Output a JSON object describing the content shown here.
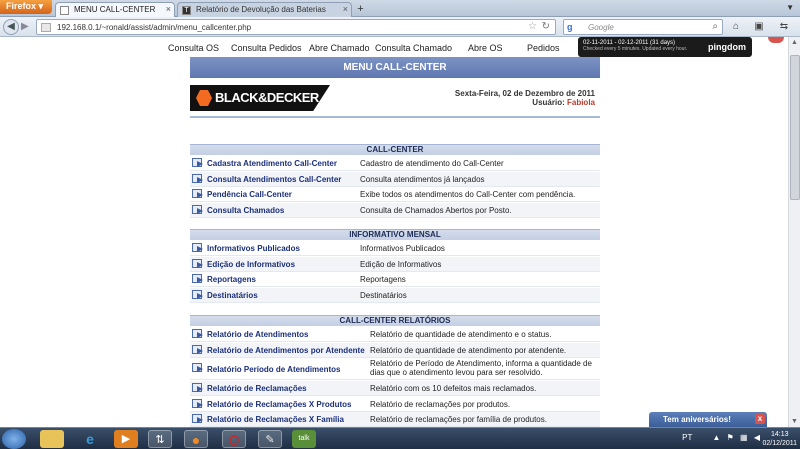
{
  "browser": {
    "menu_label": "Firefox ▾",
    "tabs": [
      {
        "title": "MENU CALL-CENTER"
      },
      {
        "title": "Relatório de Devolução das Baterias",
        "icon_letter": "T"
      }
    ],
    "url": "192.168.0.1/~ronald/assist/admin/menu_callcenter.php",
    "search_placeholder": "Google",
    "search_engine_letter": "g"
  },
  "pingdom": {
    "line1": "02-11-2011 - 02-12-2011 (31 days)",
    "line2": "Checked every 5 minutes. Updated every hour.",
    "logo": "pingdom"
  },
  "top_menu": [
    "Consulta OS",
    "Consulta Pedidos",
    "Abre Chamado",
    "Consulta Chamado",
    "Abre OS",
    "Pedidos"
  ],
  "page": {
    "header_title": "MENU CALL-CENTER",
    "brand": "BLACK&DECKER",
    "date_text": "Sexta-Feira, 02 de Dezembro de 2011",
    "user_label": "Usuário:",
    "user_name": "Fabiola"
  },
  "sections": [
    {
      "title": "CALL-CENTER",
      "rows": [
        {
          "link": "Cadastra Atendimento Call-Center",
          "desc": "Cadastro de atendimento do Call-Center"
        },
        {
          "link": "Consulta Atendimentos Call-Center",
          "desc": "Consulta atendimentos já lançados"
        },
        {
          "link": "Pendência Call-Center",
          "desc": "Exibe todos os atendimentos do Call-Center com pendência."
        },
        {
          "link": "Consulta Chamados",
          "desc": "Consulta de Chamados Abertos por Posto."
        }
      ]
    },
    {
      "title": "INFORMATIVO MENSAL",
      "rows": [
        {
          "link": "Informativos Publicados",
          "desc": "Informativos Publicados"
        },
        {
          "link": "Edição de Informativos",
          "desc": "Edição de Informativos"
        },
        {
          "link": "Reportagens",
          "desc": "Reportagens"
        },
        {
          "link": "Destinatários",
          "desc": "Destinatários"
        }
      ]
    },
    {
      "title": "CALL-CENTER RELATÓRIOS",
      "rows": [
        {
          "link": "Relatório de Atendimentos",
          "desc": "Relatório de quantidade de atendimento e o status."
        },
        {
          "link": "Relatório de Atendimentos por Atendente",
          "desc": "Relatório de quantidade de atendimento por atendente."
        },
        {
          "link": "Relatório Período de Atendimentos",
          "desc": "Relatório de Período de Atendimento, informa a quantidade de dias que o atendimento levou para ser resolvido."
        },
        {
          "link": "Relatório de Reclamações",
          "desc": "Relatório com os 10 defeitos mais reclamados."
        },
        {
          "link": "Relatório de Reclamações X Produtos",
          "desc": "Relatório de reclamações por produtos."
        },
        {
          "link": "Relatório de Reclamações X Família",
          "desc": "Relatório de reclamações por família de produtos."
        }
      ]
    }
  ],
  "popup": {
    "label": "Tem aniversários!",
    "close": "x"
  },
  "taskbar": {
    "language": "PT",
    "time": "14:13",
    "date": "02/12/2011",
    "talk_label": "talk"
  }
}
